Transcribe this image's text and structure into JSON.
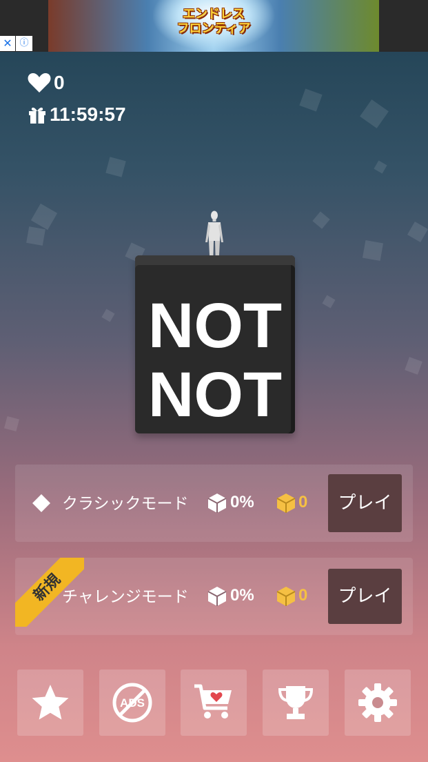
{
  "ad": {
    "title": "エンドレス\nフロンティア",
    "close_icon": "close-icon",
    "info_icon": "info-icon"
  },
  "stats": {
    "hearts": {
      "icon": "heart-icon",
      "value": "0"
    },
    "gift_timer": {
      "icon": "gift-icon",
      "value": "11:59:57"
    }
  },
  "cube": {
    "line1": "NOT",
    "line2": "NOT"
  },
  "modes": [
    {
      "icon": "diamond-icon",
      "label": "クラシックモード",
      "completion": "0%",
      "gold": "0",
      "play_label": "プレイ"
    },
    {
      "icon": "trophy-icon",
      "badge": "新規",
      "label": "チャレンジモード",
      "completion": "0%",
      "gold": "0",
      "play_label": "プレイ"
    }
  ],
  "bottom_buttons": [
    "star-icon",
    "no-ads-icon",
    "shop-cart-heart-icon",
    "trophy-icon",
    "gear-icon"
  ],
  "bottom_texts": {
    "no_ads": "ADS"
  },
  "colors": {
    "gold": "#f5c043",
    "play_button": "#5a3e40",
    "badge": "#f2b623",
    "cube": "#2a2a2a"
  }
}
